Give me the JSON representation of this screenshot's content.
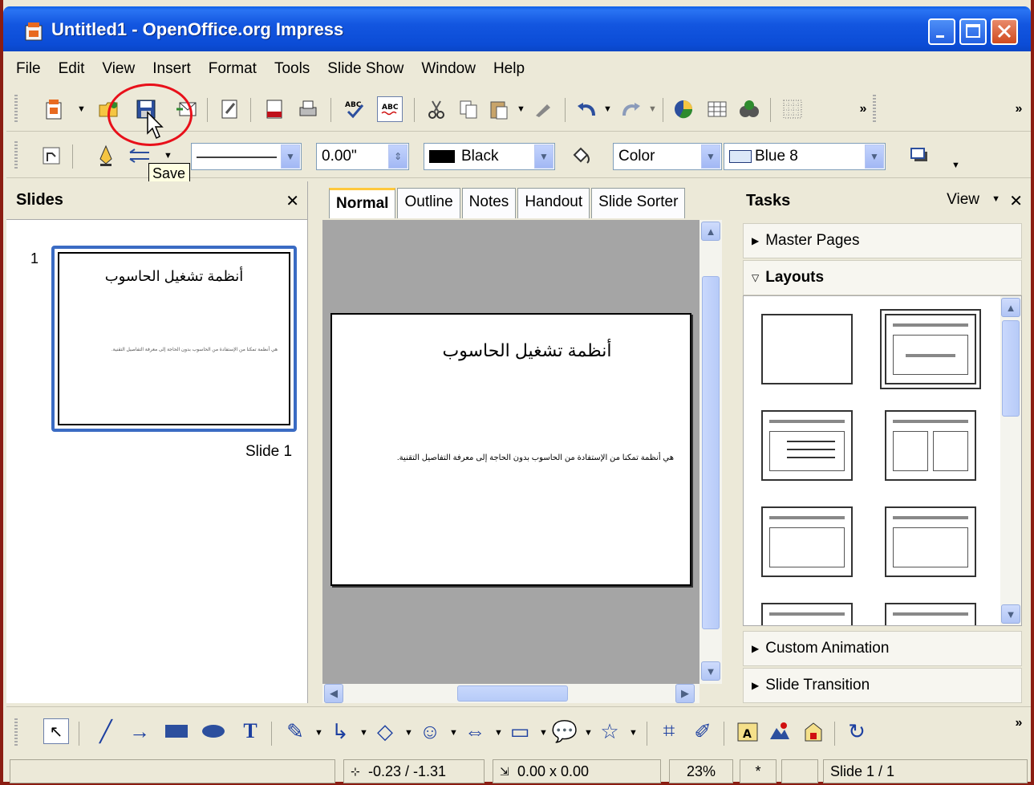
{
  "window": {
    "title": "Untitled1 - OpenOffice.org Impress"
  },
  "menu": [
    "File",
    "Edit",
    "View",
    "Insert",
    "Format",
    "Tools",
    "Slide Show",
    "Window",
    "Help"
  ],
  "toolbar": {
    "line_width_value": "0.00\"",
    "line_color_value": "Black",
    "area_style_value": "Color",
    "area_fill_value": "Blue 8",
    "tooltip": "Save"
  },
  "slides_panel": {
    "title": "Slides",
    "slide_number": "1",
    "slide_label": "Slide 1"
  },
  "slide": {
    "title": "أنظمة تشغيل الحاسوب",
    "body": "هي أنظمة تمكنا من الإستفادة من الحاسوب بدون الحاجة إلى معرفة التفاصيل التقنية."
  },
  "tabs": [
    "Normal",
    "Outline",
    "Notes",
    "Handout",
    "Slide Sorter"
  ],
  "tasks": {
    "title": "Tasks",
    "view_label": "View",
    "sections": [
      "Master Pages",
      "Layouts",
      "Custom Animation",
      "Slide Transition"
    ]
  },
  "status": {
    "position": "-0.23 / -1.31",
    "size": "0.00 x 0.00",
    "zoom": "23%",
    "modified": "*",
    "page": "Slide 1 / 1"
  }
}
